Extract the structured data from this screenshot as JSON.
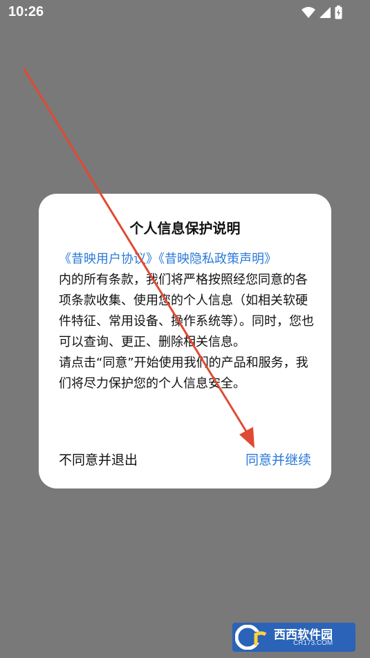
{
  "status_bar": {
    "time": "10:26",
    "icons": [
      "wifi-icon",
      "cellular-signal-icon",
      "battery-charging-icon"
    ]
  },
  "dialog": {
    "title": "个人信息保护说明",
    "links": {
      "user_agreement": "《昔映用户协议》",
      "privacy_policy": "《昔映隐私政策声明》"
    },
    "body_para1": "内的所有条款，我们将严格按照经您同意的各项条款收集、使用您的个人信息（如相关软硬件特征、常用设备、操作系统等）。同时，您也可以查询、更正、删除相关信息。",
    "body_para2": "请点击“同意”开始使用我们的产品和服务，我们将尽力保护您的个人信息安全。",
    "disagree_label": "不同意并退出",
    "agree_label": "同意并继续"
  },
  "watermark": {
    "logo_text": "西西软件园",
    "logo_sub": "CR173.COM"
  },
  "colors": {
    "overlay": "#797979",
    "dialog_bg": "#ffffff",
    "link": "#2a7ad8",
    "annotation_arrow": "#e04a33"
  }
}
